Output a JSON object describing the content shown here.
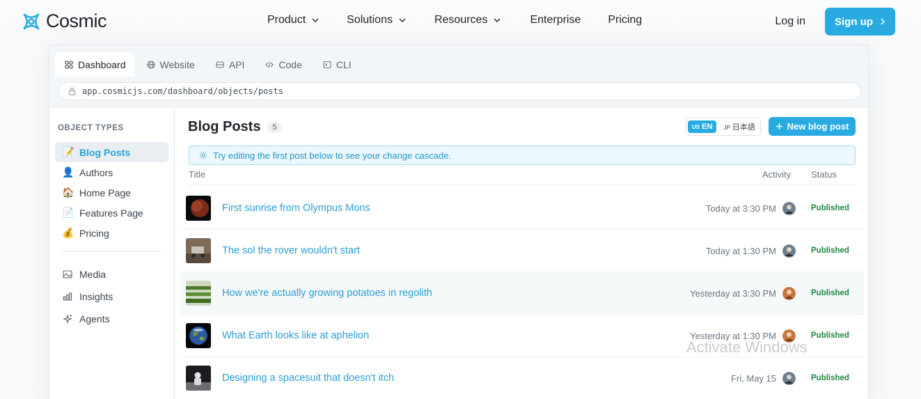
{
  "nav": {
    "logo_text": "Cosmic",
    "links": [
      {
        "label": "Product",
        "has_menu": true
      },
      {
        "label": "Solutions",
        "has_menu": true
      },
      {
        "label": "Resources",
        "has_menu": true
      },
      {
        "label": "Enterprise",
        "has_menu": false
      },
      {
        "label": "Pricing",
        "has_menu": false
      }
    ],
    "login_label": "Log in",
    "signup_label": "Sign up"
  },
  "browser": {
    "tabs": [
      "Dashboard",
      "Website",
      "API",
      "Code",
      "CLI"
    ],
    "active_tab": "Dashboard",
    "url": "app.cosmicjs.com/dashboard/objects/posts"
  },
  "sidebar": {
    "heading": "OBJECT TYPES",
    "object_types": [
      {
        "label": "Blog Posts",
        "icon": "📝",
        "active": true
      },
      {
        "label": "Authors",
        "icon": "👤",
        "active": false
      },
      {
        "label": "Home Page",
        "icon": "🏠",
        "active": false
      },
      {
        "label": "Features Page",
        "icon": "📄",
        "active": false
      },
      {
        "label": "Pricing",
        "icon": "💰",
        "active": false
      }
    ],
    "tools": [
      {
        "label": "Media",
        "icon": "image-icon"
      },
      {
        "label": "Insights",
        "icon": "chart-icon"
      },
      {
        "label": "Agents",
        "icon": "sparkle-icon"
      }
    ]
  },
  "main": {
    "title": "Blog Posts",
    "count": "5",
    "lang_en_code": "US",
    "lang_en": "EN",
    "lang_jp_code": "JP",
    "lang_jp": "日本語",
    "new_button": "New blog post",
    "tip": "Try editing the first post below to see your change cascade.",
    "columns": {
      "title": "Title",
      "activity": "Activity",
      "status": "Status"
    },
    "posts": [
      {
        "title": "First sunrise from Olympus Mons",
        "activity": "Today at 3:30 PM",
        "status": "Published",
        "thumb": "mars"
      },
      {
        "title": "The sol the rover wouldn't start",
        "activity": "Today at 1:30 PM",
        "status": "Published",
        "thumb": "rover"
      },
      {
        "title": "How we're actually growing potatoes in regolith",
        "activity": "Yesterday at 3:30 PM",
        "status": "Published",
        "thumb": "greenhouse"
      },
      {
        "title": "What Earth looks like at aphelion",
        "activity": "Yesterday at 1:30 PM",
        "status": "Published",
        "thumb": "earth"
      },
      {
        "title": "Designing a spacesuit that doesn't itch",
        "activity": "Fri, May 15",
        "status": "Published",
        "thumb": "suit"
      }
    ]
  },
  "watermark": "Activate Windows",
  "colors": {
    "accent": "#29abe2",
    "published": "#1a8a3f",
    "link": "#2a9fd4"
  }
}
